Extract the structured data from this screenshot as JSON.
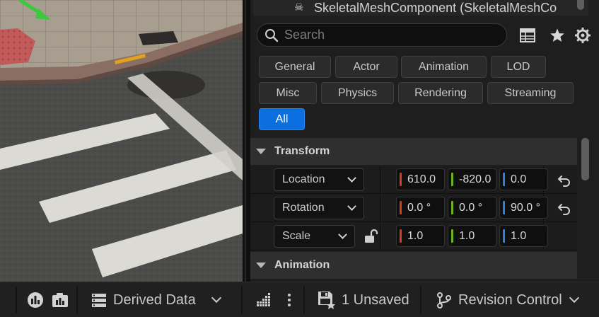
{
  "component": {
    "label": "SkeletalMeshComponent (SkeletalMeshCo",
    "icon": "skull-icon"
  },
  "search": {
    "placeholder": "Search",
    "value": ""
  },
  "toolbar": {
    "icons": [
      "table-view-icon",
      "favorites-star-icon",
      "settings-gear-icon"
    ]
  },
  "filters": [
    {
      "label": "General",
      "active": false
    },
    {
      "label": "Actor",
      "active": false
    },
    {
      "label": "Animation",
      "active": false
    },
    {
      "label": "LOD",
      "active": false
    },
    {
      "label": "Misc",
      "active": false
    },
    {
      "label": "Physics",
      "active": false
    },
    {
      "label": "Rendering",
      "active": false
    },
    {
      "label": "Streaming",
      "active": false
    },
    {
      "label": "All",
      "active": true
    }
  ],
  "sections": {
    "transform": "Transform",
    "animation": "Animation"
  },
  "transform": {
    "location": {
      "label": "Location",
      "x": "610.0",
      "y": "-820.0",
      "z": "0.0"
    },
    "rotation": {
      "label": "Rotation",
      "x": "0.0 °",
      "y": "0.0 °",
      "z": "90.0 °"
    },
    "scale": {
      "label": "Scale",
      "x": "1.0",
      "y": "1.0",
      "z": "1.0"
    }
  },
  "axis_colors": {
    "x": "#d1401f",
    "y": "#6fb21c",
    "z": "#2f7fe0"
  },
  "accent": "#0c6fe0",
  "statusbar": {
    "derived_data": "Derived Data",
    "unsaved": "1 Unsaved",
    "revision_control": "Revision Control"
  }
}
